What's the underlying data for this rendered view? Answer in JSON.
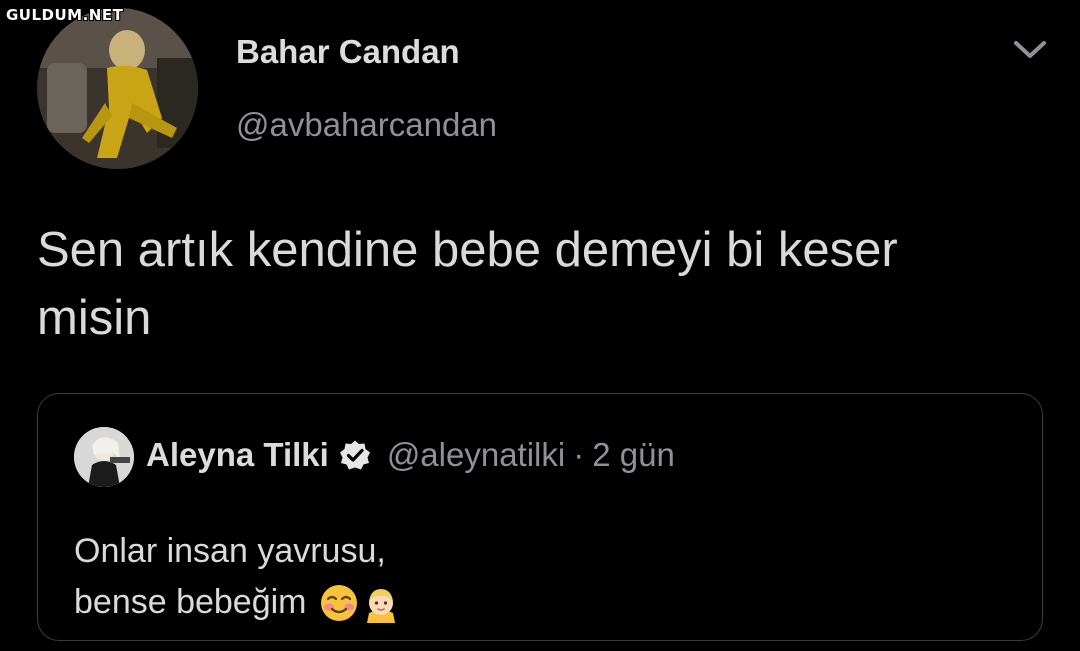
{
  "watermark": "GULDUM.NET",
  "tweet": {
    "author_name": "Bahar Candan",
    "author_handle": "@avbaharcandan",
    "text_line1": "Sen artık kendine bebe demeyi bi keser",
    "text_line2": "misin"
  },
  "quoted_tweet": {
    "author_name": "Aleyna Tilki",
    "author_handle": "@aleynatilki",
    "separator": "·",
    "time": "2 gün",
    "text_line1": "Onlar insan yavrusu,",
    "text_line2": "bense bebeğim",
    "emojis": [
      "smiling-face-icon",
      "baby-icon"
    ]
  },
  "icons": {
    "more": "chevron-down-icon",
    "verified": "verified-badge-icon"
  },
  "colors": {
    "background": "#000000",
    "primary_text": "#dadada",
    "secondary_text": "#8d9298",
    "card_border": "#3a3d41"
  }
}
